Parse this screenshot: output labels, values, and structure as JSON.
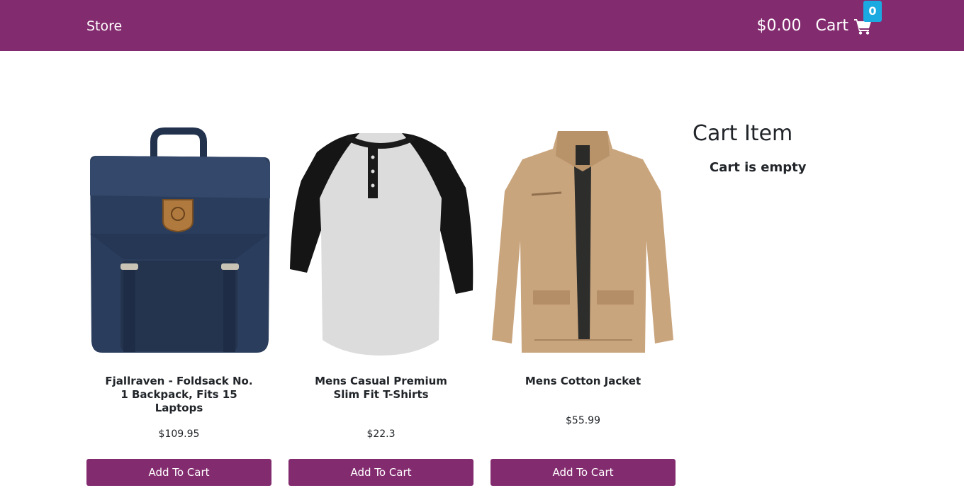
{
  "navbar": {
    "brand": "Store",
    "total": "$0.00",
    "cart_label": "Cart",
    "cart_count": "0",
    "colors": {
      "bar": "#832b6f",
      "badge": "#1aa9e0"
    }
  },
  "products": [
    {
      "title": "Fjallraven - Foldsack No. 1 Backpack, Fits 15 Laptops",
      "price": "$109.95",
      "button": "Add To Cart",
      "image": "backpack-image"
    },
    {
      "title": "Mens Casual Premium Slim Fit T-Shirts",
      "price": "$22.3",
      "button": "Add To Cart",
      "image": "raglan-tshirt-image"
    },
    {
      "title": "Mens Cotton Jacket",
      "price": "$55.99",
      "button": "Add To Cart",
      "image": "khaki-jacket-image"
    }
  ],
  "cart": {
    "heading": "Cart Item",
    "empty_text": "Cart is empty"
  }
}
